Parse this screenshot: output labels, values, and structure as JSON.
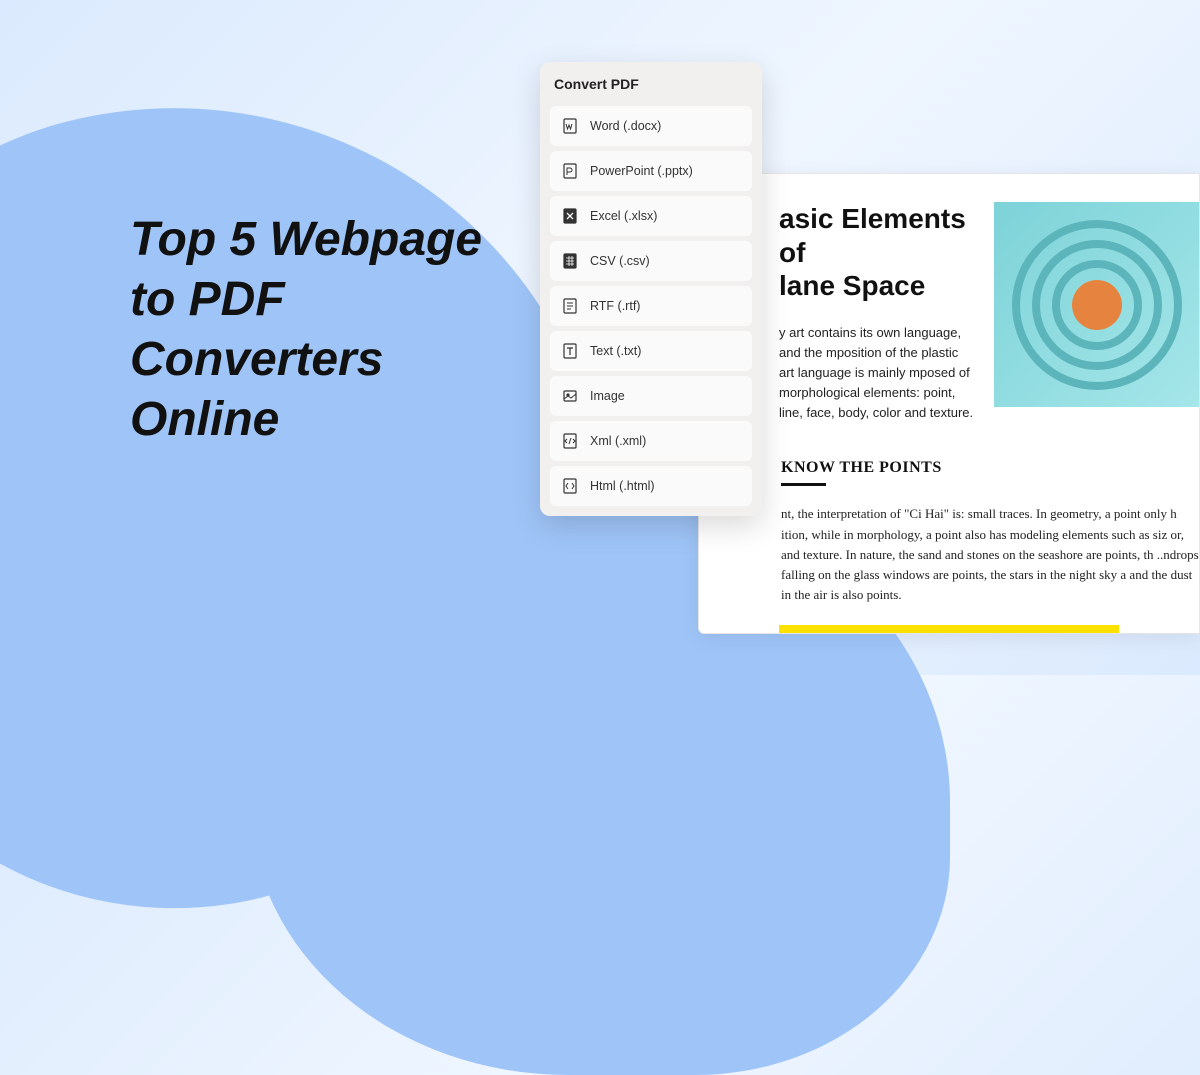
{
  "hero": {
    "title": "Top 5 Webpage to PDF Converters Online"
  },
  "panel": {
    "title": "Convert PDF",
    "options": [
      {
        "icon": "word-icon",
        "label": "Word (.docx)"
      },
      {
        "icon": "powerpoint-icon",
        "label": "PowerPoint (.pptx)"
      },
      {
        "icon": "excel-icon",
        "label": "Excel (.xlsx)"
      },
      {
        "icon": "csv-icon",
        "label": "CSV (.csv)"
      },
      {
        "icon": "rtf-icon",
        "label": "RTF (.rtf)"
      },
      {
        "icon": "text-icon",
        "label": "Text (.txt)"
      },
      {
        "icon": "image-icon",
        "label": "Image"
      },
      {
        "icon": "xml-icon",
        "label": "Xml (.xml)"
      },
      {
        "icon": "html-icon",
        "label": "Html (.html)"
      }
    ]
  },
  "document": {
    "title_line1": "asic Elements of",
    "title_line2": "lane Space",
    "para1": "y art contains its own language, and the mposition of the plastic art language is mainly mposed of morphological elements: point, line, face, body, color and texture.",
    "section_heading": "KNOW THE POINTS",
    "section_body": "nt, the interpretation of \"Ci Hai\" is: small traces. In geometry, a point only h ition, while in morphology, a point also has modeling elements such as siz or, and texture. In nature, the sand and stones on the seashore are points, th ..ndrops falling on the glass windows are points, the stars in the night sky a and the dust in the air is also points."
  }
}
